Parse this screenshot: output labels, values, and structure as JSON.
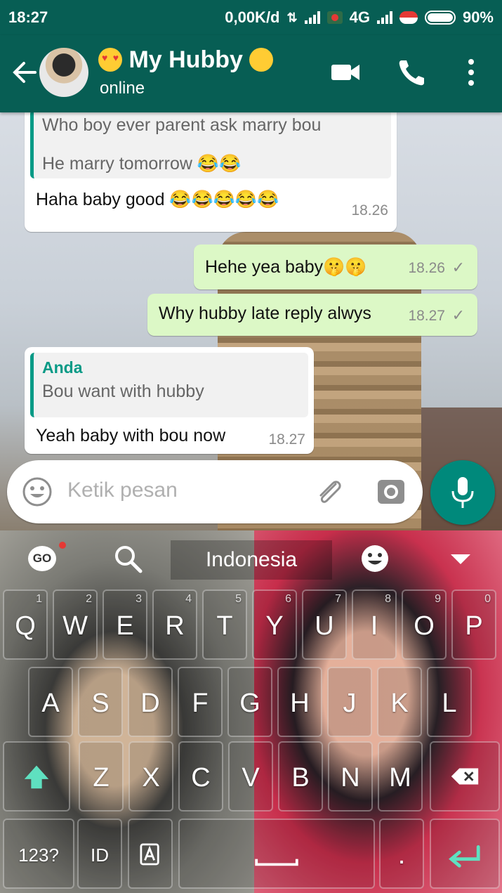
{
  "status_bar": {
    "time": "18:27",
    "speed": "0,00K/d",
    "network": "4G",
    "battery": "90%"
  },
  "header": {
    "contact_name": "My Hubby",
    "status": "online"
  },
  "messages": [
    {
      "direction": "in",
      "quote_text_1": "Who boy ever parent ask marry bou",
      "quote_text_2": "He marry tomorrow 😂😂",
      "text": "Haha baby good 😂😂😂😂😂",
      "time": "18.26"
    },
    {
      "direction": "out",
      "text": "Hehe yea baby🤫🤫",
      "time": "18.26"
    },
    {
      "direction": "out",
      "text": "Why hubby late reply alwys",
      "time": "18.27"
    },
    {
      "direction": "in",
      "quote_author": "Anda",
      "quote_text": "Bou want with hubby",
      "text": "Yeah baby with bou now",
      "time": "18.27"
    }
  ],
  "composer": {
    "placeholder": "Ketik pesan"
  },
  "keyboard": {
    "go_label": "GO",
    "language": "Indonesia",
    "row1": [
      "Q",
      "W",
      "E",
      "R",
      "T",
      "Y",
      "U",
      "I",
      "O",
      "P"
    ],
    "row1_hints": [
      "1",
      "2",
      "3",
      "4",
      "5",
      "6",
      "7",
      "8",
      "9",
      "0"
    ],
    "row2": [
      "A",
      "S",
      "D",
      "F",
      "G",
      "H",
      "J",
      "K",
      "L"
    ],
    "row3": [
      "Z",
      "X",
      "C",
      "V",
      "B",
      "N",
      "M"
    ],
    "numbers_label": "123?",
    "id_label": "ID",
    "period_label": "."
  },
  "colors": {
    "header": "#075e54",
    "outgoing_bubble": "#dcf8c6",
    "accent": "#00897b"
  }
}
